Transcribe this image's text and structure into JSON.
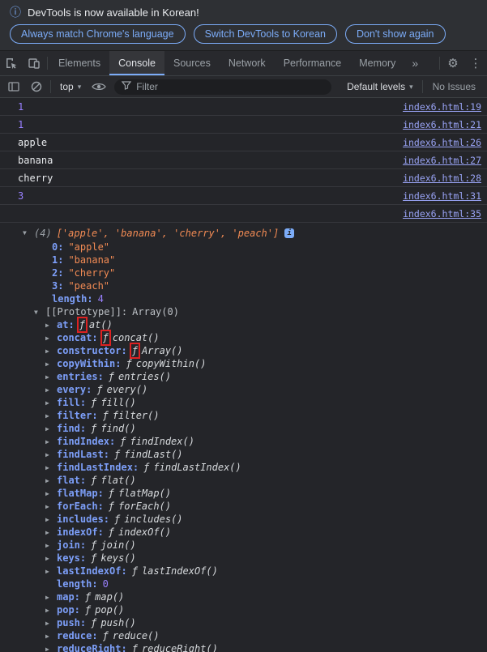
{
  "banner": {
    "message": "DevTools is now available in Korean!",
    "buttons": [
      {
        "label": "Always match Chrome's language"
      },
      {
        "label": "Switch DevTools to Korean"
      },
      {
        "label": "Don't show again"
      }
    ]
  },
  "icons": {
    "info": "ⓘ",
    "more_tabs": "»",
    "gear": "⚙",
    "dots": "⋮",
    "caret": "▾",
    "open_arrow": "▼",
    "info_chip": "i"
  },
  "colors": {
    "accent_blue": "#7cacf8",
    "link": "#99a3f5",
    "number": "#9980ff",
    "string": "#f28b54",
    "property_key": "#7d9ff9",
    "annotation_red": "#dd2222"
  },
  "tabbar": {
    "tabs": [
      {
        "label": "Elements",
        "cls": ""
      },
      {
        "label": "Console",
        "cls": "active"
      },
      {
        "label": "Sources",
        "cls": ""
      },
      {
        "label": "Network",
        "cls": ""
      },
      {
        "label": "Performance",
        "cls": ""
      },
      {
        "label": "Memory",
        "cls": ""
      }
    ]
  },
  "toolbar": {
    "context": "top",
    "filter_placeholder": "Filter",
    "levels": "Default levels",
    "issues": "No Issues"
  },
  "console": {
    "log_rows": [
      {
        "text": "1",
        "cls": "num",
        "link": "index6.html:19"
      },
      {
        "text": "1",
        "cls": "num",
        "link": "index6.html:21"
      },
      {
        "text": "apple",
        "cls": "str",
        "link": "index6.html:26"
      },
      {
        "text": "banana",
        "cls": "str",
        "link": "index6.html:27"
      },
      {
        "text": "cherry",
        "cls": "str",
        "link": "index6.html:28"
      },
      {
        "text": "3",
        "cls": "num",
        "link": "index6.html:31"
      },
      {
        "text": "",
        "cls": "empty",
        "link": "index6.html:35"
      }
    ]
  },
  "array": {
    "preview_prefix": "(4)",
    "preview_body": "['apple', 'banana', 'cherry', 'peach']",
    "items": [
      {
        "key": "0:",
        "val": "\"apple\"",
        "vcls": "str"
      },
      {
        "key": "1:",
        "val": "\"banana\"",
        "vcls": "str"
      },
      {
        "key": "2:",
        "val": "\"cherry\"",
        "vcls": "str"
      },
      {
        "key": "3:",
        "val": "\"peach\"",
        "vcls": "str"
      },
      {
        "key": "length:",
        "val": "4",
        "vcls": "num"
      }
    ],
    "prototype_label": "[[Prototype]]:",
    "prototype_value": "Array(0)",
    "proto_items": [
      {
        "arrow": "▶",
        "key": "at:",
        "f": "ƒ",
        "fn": "at()",
        "box": "boxed",
        "num": ""
      },
      {
        "arrow": "▶",
        "key": "concat:",
        "f": "ƒ",
        "fn": "concat()",
        "box": "boxed",
        "num": ""
      },
      {
        "arrow": "▶",
        "key": "constructor:",
        "f": "ƒ",
        "fn": "Array()",
        "box": "boxed",
        "num": ""
      },
      {
        "arrow": "▶",
        "key": "copyWithin:",
        "f": "ƒ",
        "fn": "copyWithin()",
        "box": "",
        "num": ""
      },
      {
        "arrow": "▶",
        "key": "entries:",
        "f": "ƒ",
        "fn": "entries()",
        "box": "",
        "num": ""
      },
      {
        "arrow": "▶",
        "key": "every:",
        "f": "ƒ",
        "fn": "every()",
        "box": "",
        "num": ""
      },
      {
        "arrow": "▶",
        "key": "fill:",
        "f": "ƒ",
        "fn": "fill()",
        "box": "",
        "num": ""
      },
      {
        "arrow": "▶",
        "key": "filter:",
        "f": "ƒ",
        "fn": "filter()",
        "box": "",
        "num": ""
      },
      {
        "arrow": "▶",
        "key": "find:",
        "f": "ƒ",
        "fn": "find()",
        "box": "",
        "num": ""
      },
      {
        "arrow": "▶",
        "key": "findIndex:",
        "f": "ƒ",
        "fn": "findIndex()",
        "box": "",
        "num": ""
      },
      {
        "arrow": "▶",
        "key": "findLast:",
        "f": "ƒ",
        "fn": "findLast()",
        "box": "",
        "num": ""
      },
      {
        "arrow": "▶",
        "key": "findLastIndex:",
        "f": "ƒ",
        "fn": "findLastIndex()",
        "box": "",
        "num": ""
      },
      {
        "arrow": "▶",
        "key": "flat:",
        "f": "ƒ",
        "fn": "flat()",
        "box": "",
        "num": ""
      },
      {
        "arrow": "▶",
        "key": "flatMap:",
        "f": "ƒ",
        "fn": "flatMap()",
        "box": "",
        "num": ""
      },
      {
        "arrow": "▶",
        "key": "forEach:",
        "f": "ƒ",
        "fn": "forEach()",
        "box": "",
        "num": ""
      },
      {
        "arrow": "▶",
        "key": "includes:",
        "f": "ƒ",
        "fn": "includes()",
        "box": "",
        "num": ""
      },
      {
        "arrow": "▶",
        "key": "indexOf:",
        "f": "ƒ",
        "fn": "indexOf()",
        "box": "",
        "num": ""
      },
      {
        "arrow": "▶",
        "key": "join:",
        "f": "ƒ",
        "fn": "join()",
        "box": "",
        "num": ""
      },
      {
        "arrow": "▶",
        "key": "keys:",
        "f": "ƒ",
        "fn": "keys()",
        "box": "",
        "num": ""
      },
      {
        "arrow": "▶",
        "key": "lastIndexOf:",
        "f": "ƒ",
        "fn": "lastIndexOf()",
        "box": "",
        "num": ""
      },
      {
        "arrow": "",
        "key": "length:",
        "f": "",
        "fn": "",
        "box": "",
        "num": "0"
      },
      {
        "arrow": "▶",
        "key": "map:",
        "f": "ƒ",
        "fn": "map()",
        "box": "",
        "num": ""
      },
      {
        "arrow": "▶",
        "key": "pop:",
        "f": "ƒ",
        "fn": "pop()",
        "box": "",
        "num": ""
      },
      {
        "arrow": "▶",
        "key": "push:",
        "f": "ƒ",
        "fn": "push()",
        "box": "",
        "num": ""
      },
      {
        "arrow": "▶",
        "key": "reduce:",
        "f": "ƒ",
        "fn": "reduce()",
        "box": "",
        "num": ""
      },
      {
        "arrow": "▶",
        "key": "reduceRight:",
        "f": "ƒ",
        "fn": "reduceRight()",
        "box": "",
        "num": ""
      }
    ]
  }
}
